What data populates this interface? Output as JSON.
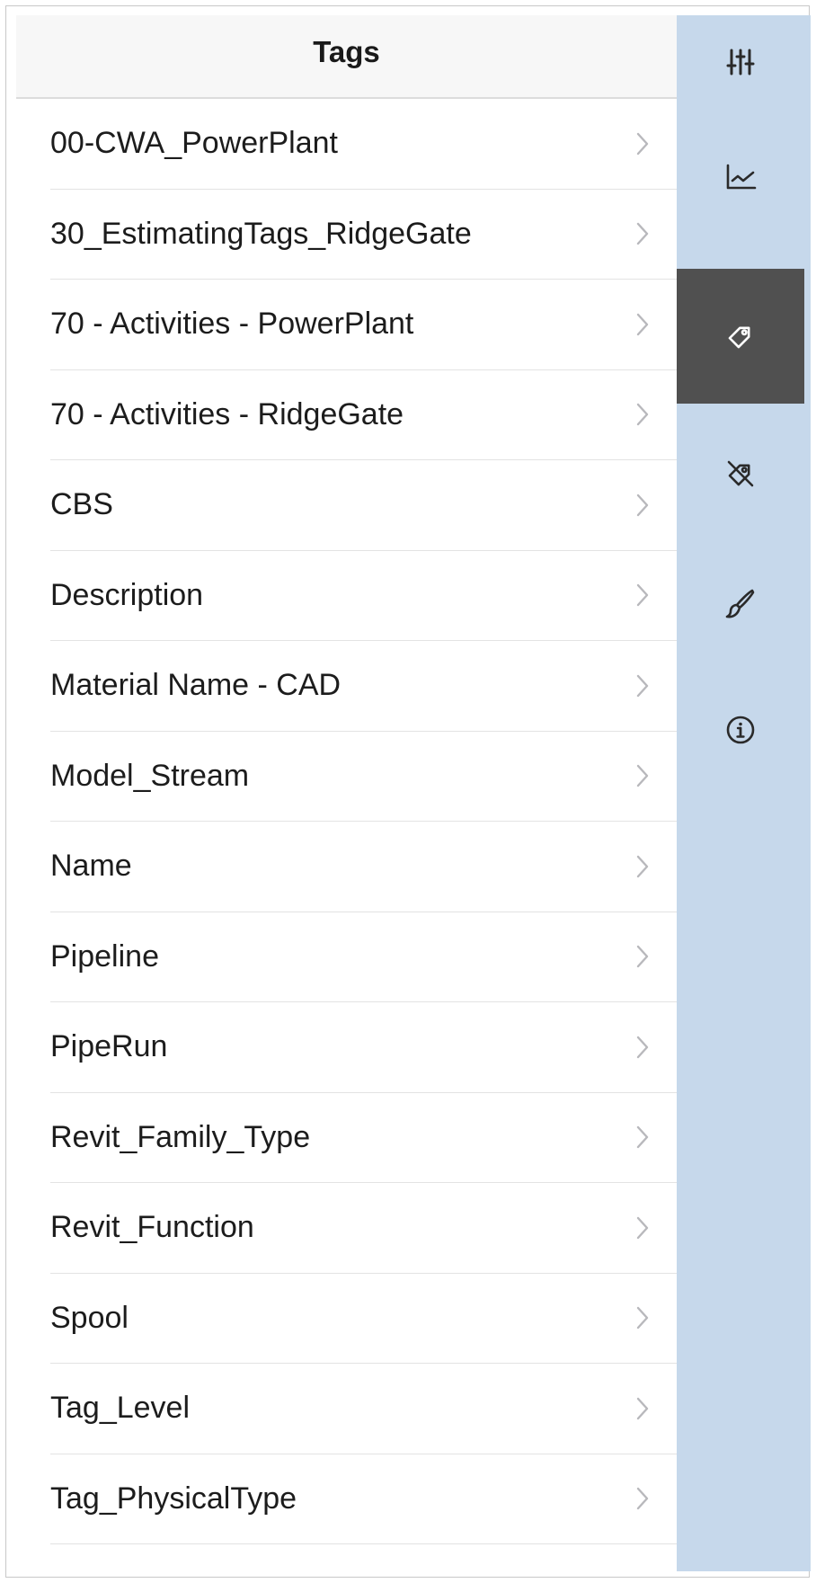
{
  "header": {
    "title": "Tags"
  },
  "tags": [
    {
      "label": "00-CWA_PowerPlant"
    },
    {
      "label": "30_EstimatingTags_RidgeGate"
    },
    {
      "label": "70 - Activities - PowerPlant"
    },
    {
      "label": "70 - Activities - RidgeGate"
    },
    {
      "label": "CBS"
    },
    {
      "label": "Description"
    },
    {
      "label": "Material Name - CAD"
    },
    {
      "label": "Model_Stream"
    },
    {
      "label": "Name"
    },
    {
      "label": "Pipeline"
    },
    {
      "label": "PipeRun"
    },
    {
      "label": "Revit_Family_Type"
    },
    {
      "label": "Revit_Function"
    },
    {
      "label": "Spool"
    },
    {
      "label": "Tag_Level"
    },
    {
      "label": "Tag_PhysicalType"
    }
  ],
  "sidebar": {
    "active": "tags",
    "buttons": [
      {
        "id": "filters",
        "icon": "sliders-icon"
      },
      {
        "id": "chart",
        "icon": "line-chart-icon"
      },
      {
        "id": "tags",
        "icon": "tag-icon"
      },
      {
        "id": "untag",
        "icon": "tag-off-icon"
      },
      {
        "id": "paint",
        "icon": "brush-icon"
      },
      {
        "id": "info",
        "icon": "info-icon"
      }
    ]
  },
  "colors": {
    "sidebar_bg": "#c6d8eb",
    "sidebar_active_bg": "#505050",
    "icon_dark": "#2a2a2a",
    "icon_light": "#ffffff",
    "chevron": "#b8b8bc"
  }
}
